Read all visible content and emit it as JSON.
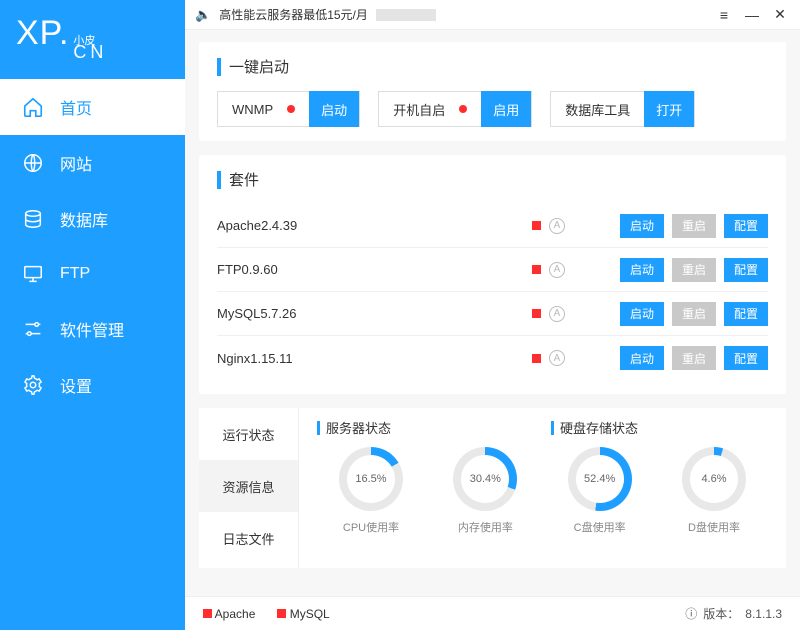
{
  "logo": {
    "main": "XP.",
    "sub_top": "小皮",
    "sub_bottom": "CN"
  },
  "nav": [
    {
      "key": "home",
      "label": "首页"
    },
    {
      "key": "website",
      "label": "网站"
    },
    {
      "key": "database",
      "label": "数据库"
    },
    {
      "key": "ftp",
      "label": "FTP"
    },
    {
      "key": "software",
      "label": "软件管理"
    },
    {
      "key": "settings",
      "label": "设置"
    }
  ],
  "titlebar": {
    "promo": "高性能云服务器最低15元/月"
  },
  "quickstart": {
    "title": "一键启动",
    "items": [
      {
        "label": "WNMP",
        "action": "启动"
      },
      {
        "label": "开机自启",
        "action": "启用"
      },
      {
        "label": "数据库工具",
        "action": "打开"
      }
    ]
  },
  "suite": {
    "title": "套件",
    "btn_start": "启动",
    "btn_restart": "重启",
    "btn_config": "配置",
    "items": [
      {
        "name": "Apache2.4.39"
      },
      {
        "name": "FTP0.9.60"
      },
      {
        "name": "MySQL5.7.26"
      },
      {
        "name": "Nginx1.15.11"
      }
    ]
  },
  "status": {
    "tabs": [
      "运行状态",
      "资源信息",
      "日志文件"
    ],
    "head_server": "服务器状态",
    "head_disk": "硬盘存储状态",
    "gauges": [
      {
        "value": "16.5%",
        "pct": 16.5,
        "label": "CPU使用率"
      },
      {
        "value": "30.4%",
        "pct": 30.4,
        "label": "内存使用率"
      },
      {
        "value": "52.4%",
        "pct": 52.4,
        "label": "C盘使用率"
      },
      {
        "value": "4.6%",
        "pct": 4.6,
        "label": "D盘使用率"
      }
    ]
  },
  "footer": {
    "items": [
      "Apache",
      "MySQL"
    ],
    "version_label": "版本：",
    "version": "8.1.1.3"
  },
  "colors": {
    "accent": "#1e9fff",
    "red": "#ff2d2d"
  }
}
